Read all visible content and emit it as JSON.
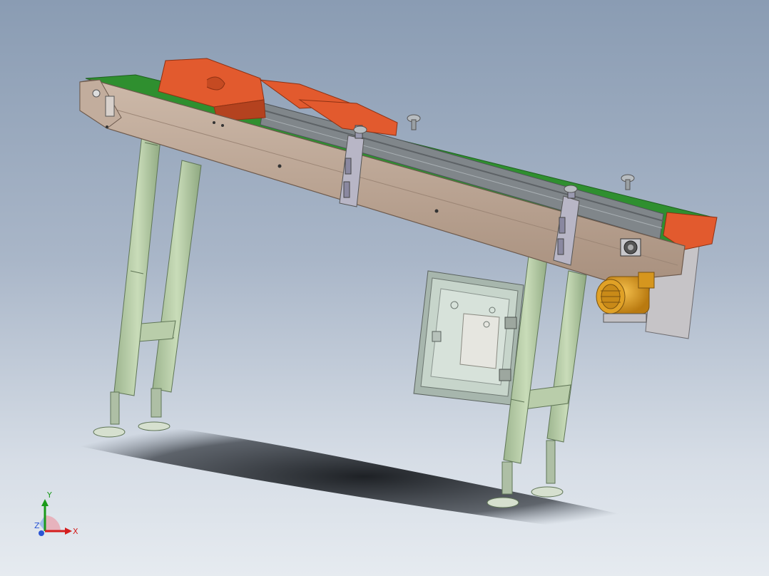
{
  "triad": {
    "x_label": "X",
    "y_label": "Y",
    "z_label": "Z"
  },
  "colors": {
    "frame": "#b8a393",
    "frame_dark": "#8f7a6c",
    "belt": "#2f8f2f",
    "product": "#e25a2e",
    "product_dark": "#a8381a",
    "legs": "#b6cfa6",
    "legs_dark": "#7f9a73",
    "guide_rail": "#7b7f80",
    "motor": "#e0a126",
    "panel": "#c9d6cc",
    "shadow": "#1b1e22"
  },
  "icons": {
    "triad": "coordinate-triad-icon"
  }
}
